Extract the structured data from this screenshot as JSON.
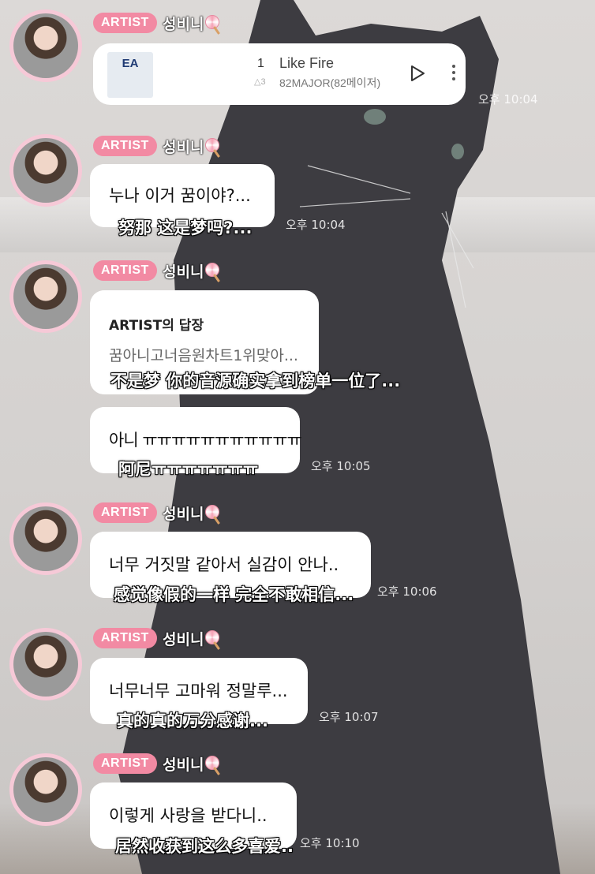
{
  "messages": [
    {
      "type": "music",
      "badge": "ARTIST",
      "name": "성비니",
      "track": {
        "rank": "1",
        "rank_change": "△3",
        "title": "Like Fire",
        "artist": "82MAJOR(82메이저)",
        "cover_text": "EA"
      },
      "time": "오후 10:04"
    },
    {
      "type": "text",
      "badge": "ARTIST",
      "name": "성비니",
      "text": "누나 이거 꿈이야?...",
      "subtitle": "努那 这是梦吗?...",
      "time": "오후 10:04"
    },
    {
      "type": "reply",
      "badge": "ARTIST",
      "name": "성비니",
      "reply_title": "ARTIST의 답장",
      "reply_body": "꿈아니고너음원차트1위맞아...",
      "subtitle": "不是梦 你的音源确实拿到榜单一位了..."
    },
    {
      "type": "text_noheader",
      "text": "아니 ㅠㅠㅠㅠㅠㅠㅠㅠㅠㅠㅠ",
      "subtitle": "阿尼ㅠㅠㅠㅠㅠㅠㅠ",
      "time": "오후 10:05"
    },
    {
      "type": "text",
      "badge": "ARTIST",
      "name": "성비니",
      "text": "너무 거짓말 같아서 실감이 안나..",
      "subtitle": "感觉像假的一样 完全不敢相信...",
      "time": "오후 10:06"
    },
    {
      "type": "text",
      "badge": "ARTIST",
      "name": "성비니",
      "text": "너무너무 고마워 정말루...",
      "subtitle": "真的真的万分感谢...",
      "time": "오후 10:07"
    },
    {
      "type": "text",
      "badge": "ARTIST",
      "name": "성비니",
      "text": "이렇게 사랑을 받다니..",
      "subtitle": "居然收获到这么多喜爱..",
      "time": "오후 10:10"
    }
  ],
  "icons": {
    "play": "play-icon",
    "more": "more-vertical-icon",
    "lollipop": "lollipop-icon"
  },
  "colors": {
    "badge": "#f28aa3",
    "avatar_ring": "#f6c9d7",
    "bubble": "#ffffff"
  }
}
